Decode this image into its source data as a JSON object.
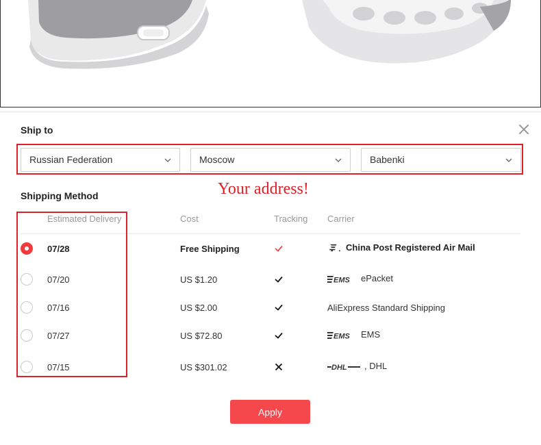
{
  "dialog": {
    "ship_to_title": "Ship to",
    "close_icon": "close-icon",
    "annotation": "Your address!",
    "shipping_method_title": "Shipping Method",
    "apply_label": "Apply"
  },
  "address": {
    "country": "Russian Federation",
    "city": "Moscow",
    "district": "Babenki"
  },
  "table": {
    "headers": {
      "delivery": "Estimated Delivery",
      "cost": "Cost",
      "tracking": "Tracking",
      "carrier": "Carrier"
    },
    "rows": [
      {
        "date": "07/28",
        "cost": "Free Shipping",
        "tracking": "check",
        "carrier": "China Post Registered Air Mail",
        "carrier_logo": "china-post-logo",
        "selected": true
      },
      {
        "date": "07/20",
        "cost": "US $1.20",
        "tracking": "check",
        "carrier": "ePacket",
        "carrier_logo": "ems-logo",
        "selected": false
      },
      {
        "date": "07/16",
        "cost": "US $2.00",
        "tracking": "check",
        "carrier": "AliExpress Standard Shipping",
        "carrier_logo": "",
        "selected": false
      },
      {
        "date": "07/27",
        "cost": "US $72.80",
        "tracking": "check",
        "carrier": "EMS",
        "carrier_logo": "ems-logo",
        "selected": false
      },
      {
        "date": "07/15",
        "cost": "US $301.02",
        "tracking": "cross",
        "carrier": ", DHL",
        "carrier_logo": "dhl-logo",
        "selected": false
      }
    ]
  },
  "colors": {
    "accent": "#f4484c",
    "annotation": "#e01f26",
    "check_selected": "#e8484c"
  }
}
